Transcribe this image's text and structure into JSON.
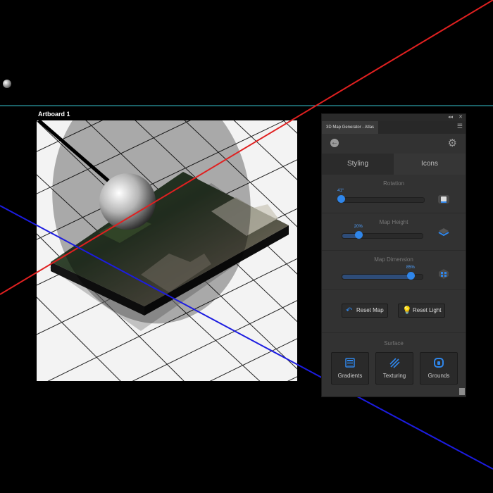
{
  "artboard": {
    "label": "Artboard 1"
  },
  "panel": {
    "window_controls": {
      "collapse": "◂◂",
      "close": "✕"
    },
    "tab_title": "3D Map Generator - Atlas",
    "menu_icon": "hamburger-menu-icon",
    "toolbar": {
      "back_icon": "back-arrow-icon",
      "settings_icon": "gear-icon"
    },
    "tabs": [
      {
        "label": "Styling",
        "active": true
      },
      {
        "label": "Icons",
        "active": false
      }
    ],
    "rotation": {
      "title": "Rotation",
      "value_label": "41°",
      "value": 0.03
    },
    "map_height": {
      "title": "Map Height",
      "value_label": "20%",
      "value": 0.2
    },
    "map_dimension": {
      "title": "Map Dimension",
      "value_label": "85%",
      "value": 0.85
    },
    "buttons": {
      "reset_map": "Reset Map",
      "reset_light": "Reset Light"
    },
    "surface": {
      "title": "Surface",
      "tiles": [
        {
          "label": "Gradients",
          "icon": "gradient-icon"
        },
        {
          "label": "Texturing",
          "icon": "texture-stripes-icon"
        },
        {
          "label": "Grounds",
          "icon": "ground-icon"
        }
      ]
    }
  },
  "colors": {
    "accent": "#2f86ea",
    "x_axis": "#e02020",
    "z_axis": "#2020e0",
    "guide": "#36c5d0"
  }
}
